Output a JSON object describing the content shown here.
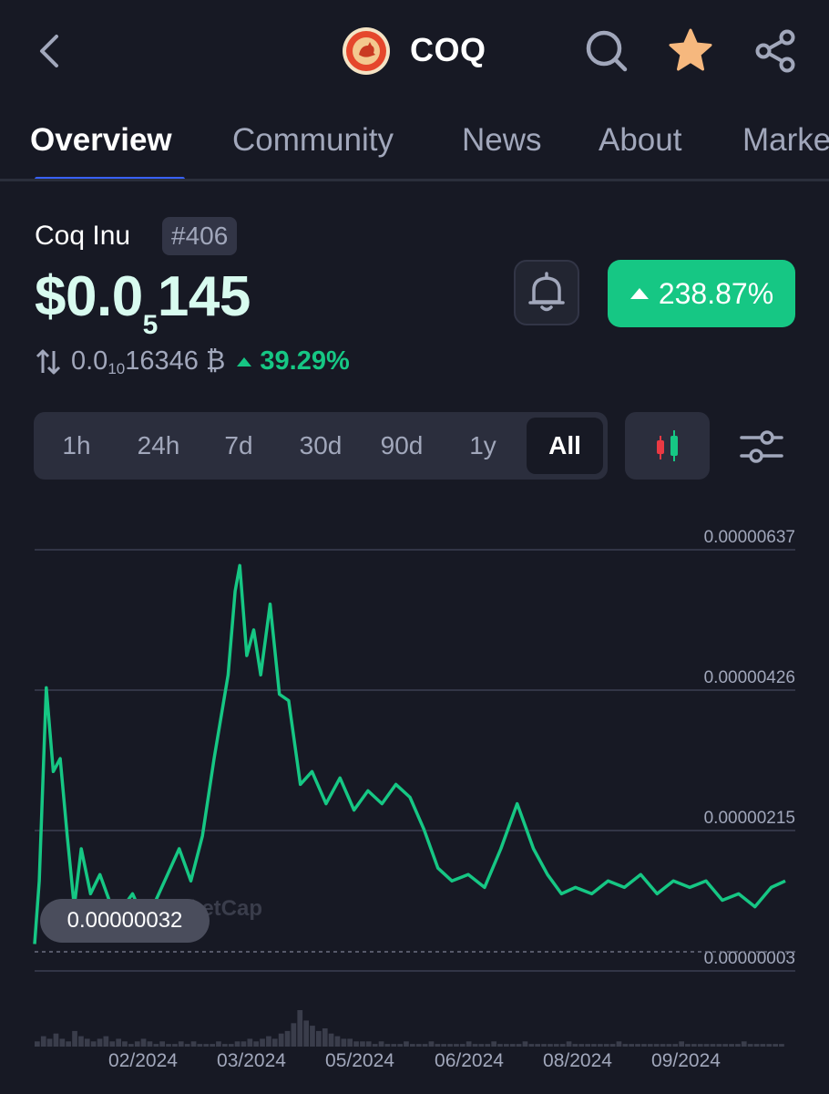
{
  "header": {
    "title": "COQ",
    "star_color": "#f6b87e",
    "icons": [
      "back-icon",
      "search-icon",
      "star-icon",
      "share-icon"
    ]
  },
  "tabs": [
    {
      "label": "Overview",
      "active": true
    },
    {
      "label": "Community",
      "active": false
    },
    {
      "label": "News",
      "active": false
    },
    {
      "label": "About",
      "active": false
    },
    {
      "label": "Markets",
      "active": false
    }
  ],
  "coin": {
    "name": "Coq Inu",
    "rank": "#406",
    "price_prefix": "$0.0",
    "price_zero_count": "5",
    "price_digits": "145",
    "change_percent": "238.87%",
    "btc_prefix": "0.0",
    "btc_zero_count": "10",
    "btc_digits": "16346",
    "btc_symbol": "₿",
    "btc_change": "39.29%",
    "up_color": "#16c784"
  },
  "ranges": [
    {
      "label": "1h",
      "active": false
    },
    {
      "label": "24h",
      "active": false
    },
    {
      "label": "7d",
      "active": false
    },
    {
      "label": "30d",
      "active": false
    },
    {
      "label": "90d",
      "active": false
    },
    {
      "label": "1y",
      "active": false
    },
    {
      "label": "All",
      "active": true
    }
  ],
  "chart_data": {
    "type": "line",
    "y_tick_labels": [
      "0.00000637",
      "0.00000426",
      "0.00000215",
      "0.00000003"
    ],
    "y_ticks": [
      6.37e-06,
      4.26e-06,
      2.15e-06,
      3e-08
    ],
    "ylim": [
      2e-07,
      6.6e-06
    ],
    "x_tick_labels": [
      "02/2024",
      "03/2024",
      "05/2024",
      "06/2024",
      "08/2024",
      "09/2024"
    ],
    "current_low_label": "0.00000032",
    "watermark": "CoinMarketCap",
    "series": [
      {
        "color": "#16c784",
        "x": [
          "2023-12-09",
          "2023-12-11",
          "2023-12-14",
          "2023-12-17",
          "2023-12-20",
          "2023-12-23",
          "2023-12-26",
          "2023-12-29",
          "2024-01-02",
          "2024-01-06",
          "2024-01-10",
          "2024-01-15",
          "2024-01-20",
          "2024-01-25",
          "2024-01-30",
          "2024-02-04",
          "2024-02-09",
          "2024-02-14",
          "2024-02-19",
          "2024-02-24",
          "2024-03-01",
          "2024-03-04",
          "2024-03-06",
          "2024-03-09",
          "2024-03-12",
          "2024-03-15",
          "2024-03-19",
          "2024-03-23",
          "2024-03-27",
          "2024-04-01",
          "2024-04-06",
          "2024-04-12",
          "2024-04-18",
          "2024-04-24",
          "2024-04-30",
          "2024-05-06",
          "2024-05-12",
          "2024-05-18",
          "2024-05-24",
          "2024-05-30",
          "2024-06-05",
          "2024-06-12",
          "2024-06-19",
          "2024-06-26",
          "2024-07-03",
          "2024-07-10",
          "2024-07-16",
          "2024-07-22",
          "2024-07-28",
          "2024-08-04",
          "2024-08-11",
          "2024-08-18",
          "2024-08-25",
          "2024-09-01",
          "2024-09-08",
          "2024-09-15",
          "2024-09-22",
          "2024-09-29",
          "2024-10-06",
          "2024-10-13",
          "2024-10-20",
          "2024-10-26"
        ],
        "values": [
          3.2e-07,
          1.3e-06,
          4.3e-06,
          3e-06,
          3.2e-06,
          2e-06,
          9e-07,
          1.8e-06,
          1.1e-06,
          1.4e-06,
          1e-06,
          8.5e-07,
          1.1e-06,
          7e-07,
          1e-06,
          1.4e-06,
          1.8e-06,
          1.3e-06,
          2e-06,
          3.2e-06,
          4.5e-06,
          5.8e-06,
          6.2e-06,
          4.8e-06,
          5.2e-06,
          4.5e-06,
          5.6e-06,
          4.2e-06,
          4.1e-06,
          2.8e-06,
          3e-06,
          2.5e-06,
          2.9e-06,
          2.4e-06,
          2.7e-06,
          2.5e-06,
          2.8e-06,
          2.6e-06,
          2.1e-06,
          1.5e-06,
          1.3e-06,
          1.4e-06,
          1.2e-06,
          1.8e-06,
          2.5e-06,
          1.8e-06,
          1.4e-06,
          1.1e-06,
          1.2e-06,
          1.1e-06,
          1.3e-06,
          1.2e-06,
          1.4e-06,
          1.1e-06,
          1.3e-06,
          1.2e-06,
          1.3e-06,
          1e-06,
          1.1e-06,
          9e-07,
          1.2e-06,
          1.3e-06
        ]
      }
    ],
    "volume": [
      2,
      4,
      3,
      5,
      3,
      2,
      6,
      4,
      3,
      2,
      3,
      4,
      2,
      3,
      2,
      1,
      2,
      3,
      2,
      1,
      2,
      1,
      1,
      2,
      1,
      2,
      1,
      1,
      1,
      2,
      1,
      1,
      2,
      2,
      3,
      2,
      3,
      4,
      3,
      5,
      6,
      9,
      14,
      10,
      8,
      6,
      7,
      5,
      4,
      3,
      3,
      2,
      2,
      2,
      1,
      2,
      1,
      1,
      1,
      2,
      1,
      1,
      1,
      2,
      1,
      1,
      1,
      1,
      1,
      2,
      1,
      1,
      1,
      2,
      1,
      1,
      1,
      1,
      2,
      1,
      1,
      1,
      1,
      1,
      1,
      2,
      1,
      1,
      1,
      1,
      1,
      1,
      1,
      2,
      1,
      1,
      1,
      1,
      1,
      1,
      1,
      1,
      1,
      2,
      1,
      1,
      1,
      1,
      1,
      1,
      1,
      1,
      1,
      2,
      1,
      1,
      1,
      1,
      1,
      1
    ]
  }
}
